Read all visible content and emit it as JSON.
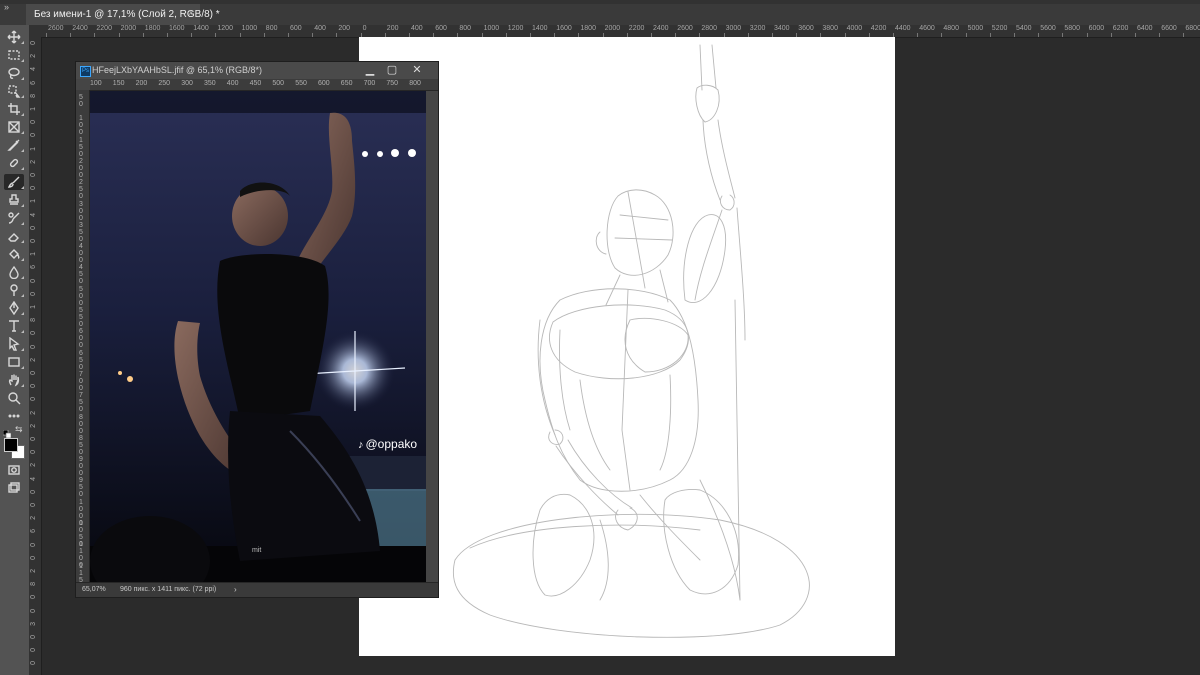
{
  "app": {
    "collapse_glyph": "»"
  },
  "tabs": [
    {
      "label": "Без имени-1 @ 17,1% (Слой 2, RGB/8) *",
      "close": "×"
    }
  ],
  "toolbar": {
    "tools": [
      "move-icon",
      "marquee-icon",
      "lasso-icon",
      "object-select-icon",
      "crop-icon",
      "frame-icon",
      "eyedropper-icon",
      "healing-icon",
      "brush-icon",
      "stamp-icon",
      "history-brush-icon",
      "eraser-icon",
      "bucket-icon",
      "blur-icon",
      "dodge-icon",
      "pen-icon",
      "type-icon",
      "path-select-icon",
      "rectangle-icon",
      "hand-icon",
      "zoom-icon",
      "more-icon"
    ],
    "active_tool": "brush-icon",
    "foreground": "#000000",
    "background": "#ffffff",
    "swap_glyph": "⇆"
  },
  "ruler_top": [
    "2600",
    "2400",
    "2200",
    "2000",
    "1800",
    "1600",
    "1400",
    "1200",
    "1000",
    "800",
    "600",
    "400",
    "200",
    "0",
    "200",
    "400",
    "600",
    "800",
    "1000",
    "1200",
    "1400",
    "1600",
    "1800",
    "2000",
    "2200",
    "2400",
    "2600",
    "2800",
    "3000",
    "3200",
    "3400",
    "3600",
    "3800",
    "4000",
    "4200",
    "4400",
    "4600",
    "4800",
    "5000",
    "5200",
    "5400",
    "5600",
    "5800",
    "6000",
    "6200",
    "6400",
    "6600",
    "6800"
  ],
  "ruler_left": [
    "0",
    "2",
    "4",
    "6",
    "8",
    "1",
    "0",
    "0",
    "1",
    "2",
    "0",
    "0",
    "1",
    "4",
    "0",
    "0",
    "1",
    "6",
    "0",
    "0",
    "1",
    "8",
    "0",
    "0",
    "2",
    "0",
    "0",
    "0",
    "2",
    "2",
    "0",
    "0",
    "2",
    "4",
    "0",
    "0",
    "2",
    "6",
    "0",
    "0",
    "2",
    "8",
    "0",
    "0",
    "3",
    "0",
    "0",
    "0"
  ],
  "ref_window": {
    "title": "HFeejLXbYAAHbSL.jfif @ 65,1% (RGB/8*)",
    "minimize": "▁",
    "maximize": "▢",
    "close": "✕",
    "ruler": [
      "100",
      "150",
      "200",
      "250",
      "300",
      "350",
      "400",
      "450",
      "500",
      "550",
      "600",
      "650",
      "700",
      "750",
      "800"
    ],
    "ruler_left": [
      "5\n0",
      "1\n0\n0",
      "1\n5\n0",
      "2\n0\n0",
      "2\n5\n0",
      "3\n0\n0",
      "3\n5\n0",
      "4\n0\n0",
      "4\n5\n0",
      "5\n0\n0",
      "5\n5\n0",
      "6\n0\n0",
      "6\n5\n0",
      "7\n0\n0",
      "7\n5\n0",
      "8\n0\n0",
      "8\n5\n0",
      "9\n0\n0",
      "9\n5\n0",
      "1\n0\n0\n0",
      "1\n0\n5\n0",
      "1\n1\n0\n0",
      "1\n1\n5\n0"
    ],
    "watermark": "@oppako",
    "status": {
      "zoom": "65,07%",
      "doc_size": "960 пикс. x 1411 пикс. (72 ppi)",
      "arrow": "›"
    }
  },
  "colors": {
    "workspace": "#2b2b2b",
    "toolbar": "#535353",
    "canvas": "#ffffff",
    "sketch_stroke": "#b8b8b8"
  }
}
